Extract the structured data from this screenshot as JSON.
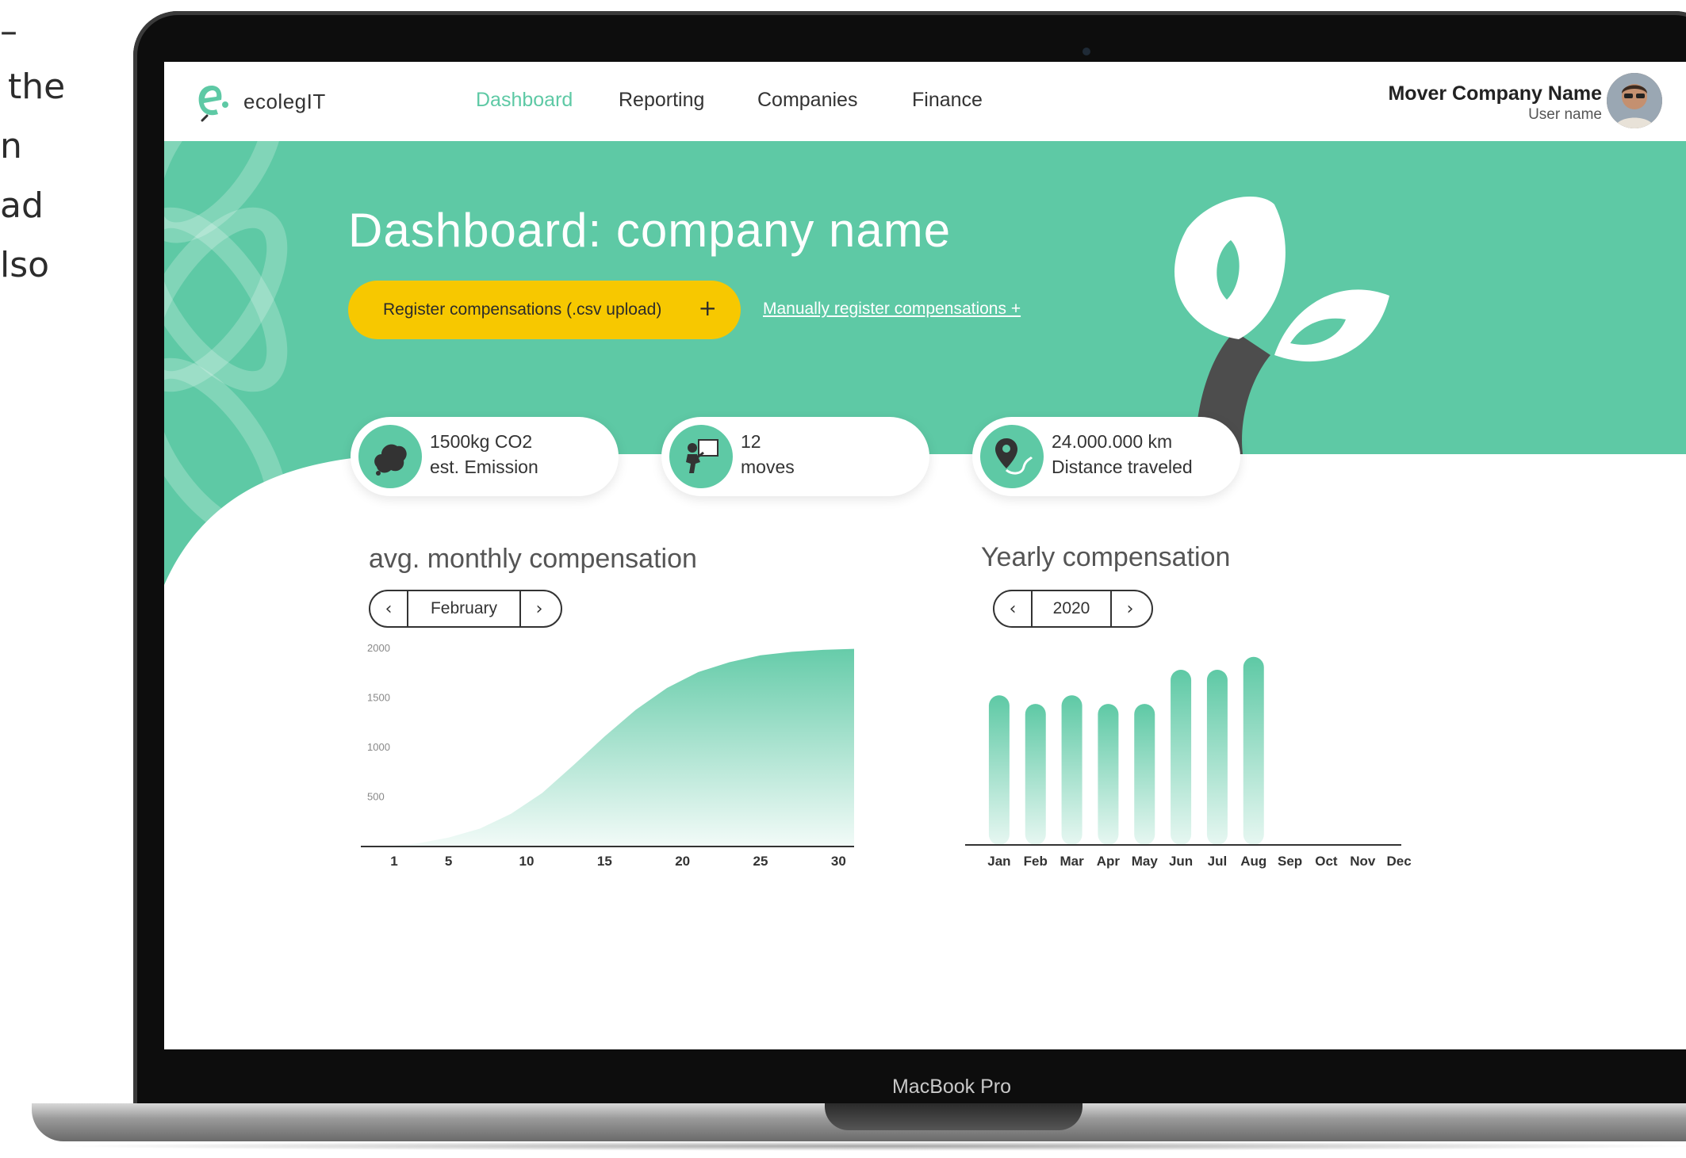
{
  "side_text": [
    "–",
    "the",
    "n",
    "ad",
    "lso"
  ],
  "device": {
    "label": "MacBook Pro"
  },
  "nav": {
    "logo_text": "ecolegIT",
    "links": [
      {
        "label": "Dashboard",
        "active": true
      },
      {
        "label": "Reporting",
        "active": false
      },
      {
        "label": "Companies",
        "active": false
      },
      {
        "label": "Finance",
        "active": false
      }
    ],
    "company_name": "Mover Company Name",
    "user_name": "User name"
  },
  "hero": {
    "title": "Dashboard: company name",
    "csv_button": "Register compensations (.csv upload)",
    "csv_button_icon": "+",
    "manual_link": "Manually register compensations +"
  },
  "stats": [
    {
      "icon": "smoke-cloud-icon",
      "line1": "1500kg CO2",
      "line2": "est. Emission"
    },
    {
      "icon": "mover-box-icon",
      "line1": "12",
      "line2": "moves"
    },
    {
      "icon": "route-pin-icon",
      "line1": "24.000.000 km",
      "line2": "Distance traveled"
    }
  ],
  "monthly": {
    "title": "avg. monthly compensation",
    "selector_value": "February",
    "prev": "‹",
    "next": "›"
  },
  "yearly": {
    "title": "Yearly compensation",
    "selector_value": "2020",
    "prev": "‹",
    "next": "›"
  },
  "colors": {
    "accent": "#5ec9a5",
    "button": "#f7c800",
    "hero_bg": "#5ec9a5",
    "text": "#333333"
  },
  "chart_data": [
    {
      "type": "area",
      "title": "avg. monthly compensation",
      "x_ticks": [
        "1",
        "5",
        "10",
        "15",
        "20",
        "25",
        "30"
      ],
      "y_ticks": [
        "2000",
        "1500",
        "1000",
        "500"
      ],
      "ylim": [
        0,
        2000
      ],
      "xlim": [
        1,
        31
      ],
      "x": [
        1,
        3,
        5,
        7,
        9,
        11,
        13,
        15,
        17,
        19,
        21,
        23,
        25,
        27,
        29,
        31
      ],
      "values": [
        0,
        30,
        90,
        180,
        330,
        540,
        820,
        1110,
        1380,
        1600,
        1760,
        1860,
        1930,
        1965,
        1985,
        1995
      ],
      "grid": false
    },
    {
      "type": "bar",
      "title": "Yearly compensation",
      "categories": [
        "Jan",
        "Feb",
        "Mar",
        "Apr",
        "May",
        "Jun",
        "Jul",
        "Aug",
        "Sep",
        "Oct",
        "Nov",
        "Dec"
      ],
      "values": [
        1750,
        1650,
        1750,
        1650,
        1650,
        2050,
        2050,
        2200,
        0,
        0,
        0,
        0
      ],
      "ylim": [
        0,
        2300
      ],
      "grid": false
    }
  ]
}
